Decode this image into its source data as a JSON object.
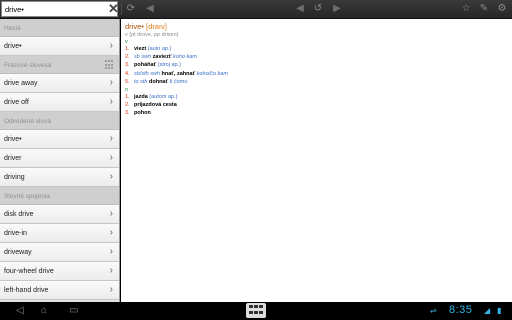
{
  "search": {
    "value": "drive•",
    "clear_icon": "✕"
  },
  "toolbar": {
    "refresh_icon": "⟳",
    "back_icon": "◀",
    "forward_icon": "▶",
    "history_icon": "↺",
    "star_icon": "☆",
    "settings_icon": "⚙",
    "wrench_icon": "✎",
    "gear_icon": "⚙"
  },
  "sidebar": {
    "sections": [
      {
        "header": "Heslá",
        "items": [
          "drive•"
        ]
      },
      {
        "header": "Frázové slovesá",
        "items": [
          "drive away",
          "drive off"
        ],
        "has_grid_icon": true
      },
      {
        "header": "Odvodené slová",
        "items": [
          "drive•",
          "driver",
          "driving"
        ]
      },
      {
        "header": "Slovné spojenia",
        "items": [
          "disk drive",
          "drive-in",
          "driveway",
          "four-wheel drive",
          "left-hand drive"
        ]
      }
    ],
    "chevron": "›"
  },
  "entry": {
    "headword": "drive•",
    "pronunciation": "[draıv]",
    "grammar": "v (pt drove, pp driven)",
    "verb_pos": "v",
    "noun_pos": "n",
    "verb_senses": [
      {
        "num": "1.",
        "word": "viezt",
        "label": "(auto ap.)"
      },
      {
        "num": "2.",
        "prefix": "sb swh",
        "word": "zaviezť",
        "label": "koho kam"
      },
      {
        "num": "3.",
        "word": "poháňať",
        "label": "(stroj ap.)"
      },
      {
        "num": "4.",
        "prefix": "sb/sth swh",
        "word": "hnať, zahnať",
        "label": "koho/čo kam"
      },
      {
        "num": "5.",
        "prefix": "to sth",
        "word": "dohnať",
        "label": "k čomu"
      }
    ],
    "noun_senses": [
      {
        "num": "1.",
        "word": "jazda",
        "label": "(autom ap.)"
      },
      {
        "num": "2.",
        "word": "príjazdová cesta"
      },
      {
        "num": "3.",
        "word": "pohon"
      }
    ]
  },
  "system": {
    "back_icon": "◁",
    "home_icon": "⌂",
    "recent_icon": "▭",
    "keyboard_icon": "keyboard-grid",
    "clock": "8:35",
    "usb_icon": "⇌",
    "wifi_icon": "◢",
    "battery_icon": "▮"
  }
}
